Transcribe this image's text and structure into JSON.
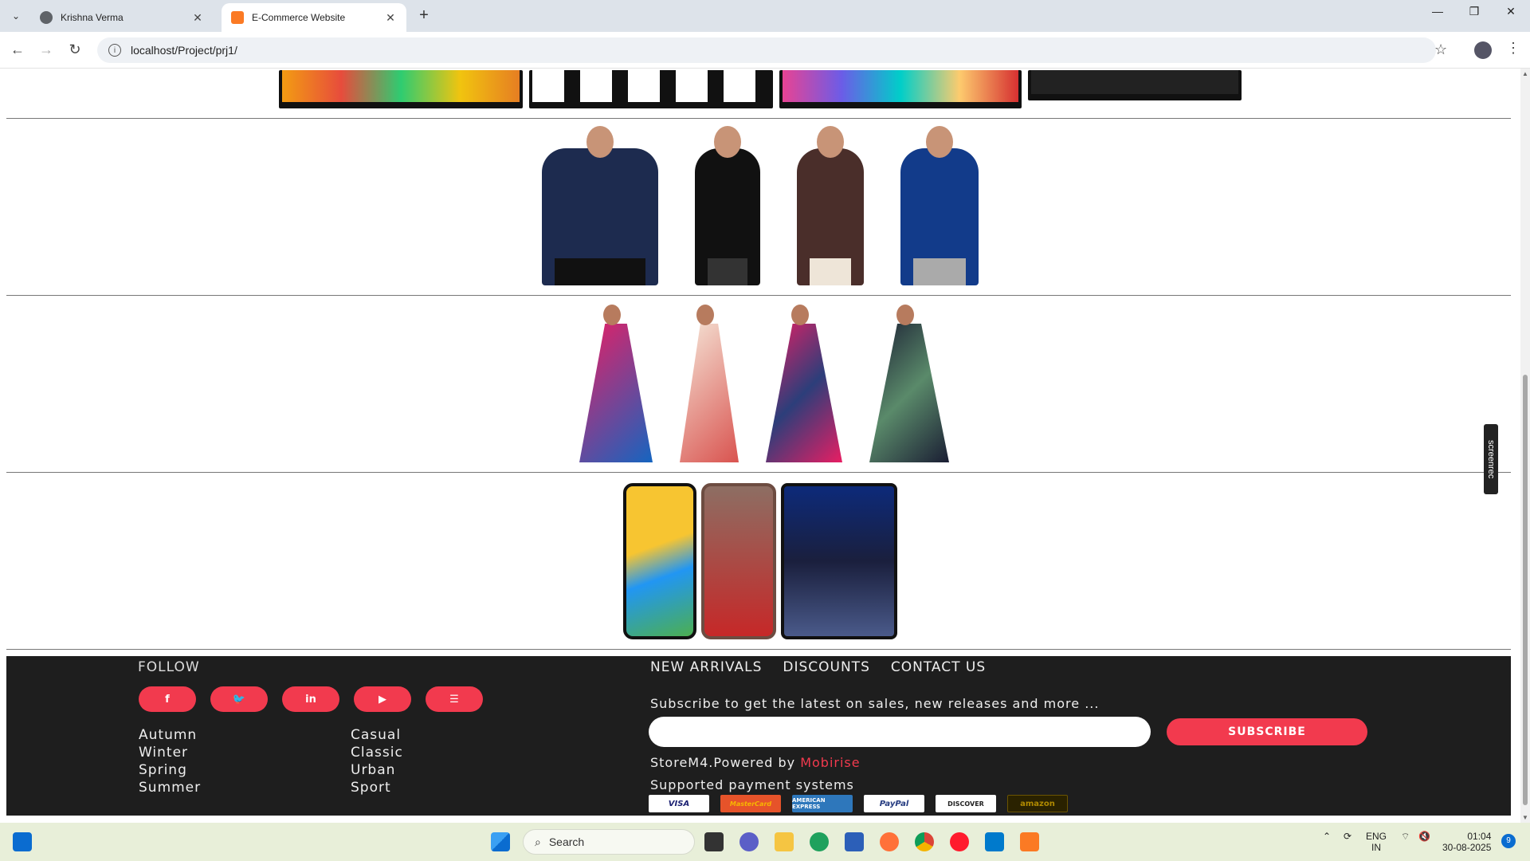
{
  "browser": {
    "tabs": [
      {
        "title": "Krishna Verma",
        "active": false,
        "favicon": "globe-icon"
      },
      {
        "title": "E-Commerce Website",
        "active": true,
        "favicon": "xampp-icon"
      }
    ],
    "url": "localhost/Project/prj1/"
  },
  "footer": {
    "follow_label": "FOLLOW",
    "social": [
      {
        "name": "facebook-icon",
        "glyph": "f"
      },
      {
        "name": "twitter-icon",
        "glyph": "🐦"
      },
      {
        "name": "linkedin-icon",
        "glyph": "in"
      },
      {
        "name": "youtube-icon",
        "glyph": "▶"
      },
      {
        "name": "rss-icon",
        "glyph": "☰"
      }
    ],
    "seasons": [
      "Autumn",
      "Winter",
      "Spring",
      "Summer"
    ],
    "styles": [
      "Casual",
      "Classic",
      "Urban",
      "Sport"
    ],
    "nav": [
      "NEW ARRIVALS",
      "DISCOUNTS",
      "CONTACT US"
    ],
    "subscribe_text": "Subscribe to get the latest on sales, new releases and more ...",
    "email_placeholder": "",
    "subscribe_label": "SUBSCRIBE",
    "powered_prefix": "StoreM4.Powered by ",
    "powered_brand": "Mobirise",
    "payments_title": "Supported payment systems",
    "payments": [
      "VISA",
      "MasterCard",
      "AMERICAN EXPRESS",
      "PayPal",
      "DISCOVER",
      "amazon"
    ]
  },
  "overlay": {
    "screenrec_label": "screenrec"
  },
  "taskbar": {
    "search_label": "Search",
    "lang_top": "ENG",
    "lang_bottom": "IN",
    "time": "01:04",
    "date": "30-08-2025",
    "notifications": "9"
  },
  "colors": {
    "accent": "#f23a4e",
    "footer_bg": "#1e1e1e"
  }
}
